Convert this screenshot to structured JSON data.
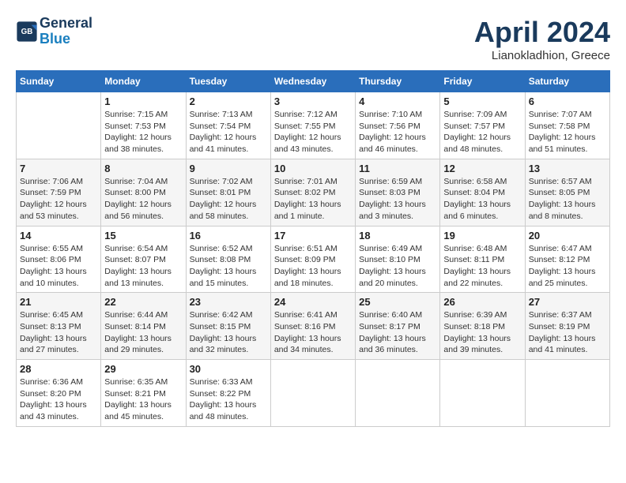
{
  "header": {
    "logo_line1": "General",
    "logo_line2": "Blue",
    "month": "April 2024",
    "location": "Lianokladhion, Greece"
  },
  "weekdays": [
    "Sunday",
    "Monday",
    "Tuesday",
    "Wednesday",
    "Thursday",
    "Friday",
    "Saturday"
  ],
  "weeks": [
    [
      {
        "day": "",
        "info": ""
      },
      {
        "day": "1",
        "info": "Sunrise: 7:15 AM\nSunset: 7:53 PM\nDaylight: 12 hours\nand 38 minutes."
      },
      {
        "day": "2",
        "info": "Sunrise: 7:13 AM\nSunset: 7:54 PM\nDaylight: 12 hours\nand 41 minutes."
      },
      {
        "day": "3",
        "info": "Sunrise: 7:12 AM\nSunset: 7:55 PM\nDaylight: 12 hours\nand 43 minutes."
      },
      {
        "day": "4",
        "info": "Sunrise: 7:10 AM\nSunset: 7:56 PM\nDaylight: 12 hours\nand 46 minutes."
      },
      {
        "day": "5",
        "info": "Sunrise: 7:09 AM\nSunset: 7:57 PM\nDaylight: 12 hours\nand 48 minutes."
      },
      {
        "day": "6",
        "info": "Sunrise: 7:07 AM\nSunset: 7:58 PM\nDaylight: 12 hours\nand 51 minutes."
      }
    ],
    [
      {
        "day": "7",
        "info": "Sunrise: 7:06 AM\nSunset: 7:59 PM\nDaylight: 12 hours\nand 53 minutes."
      },
      {
        "day": "8",
        "info": "Sunrise: 7:04 AM\nSunset: 8:00 PM\nDaylight: 12 hours\nand 56 minutes."
      },
      {
        "day": "9",
        "info": "Sunrise: 7:02 AM\nSunset: 8:01 PM\nDaylight: 12 hours\nand 58 minutes."
      },
      {
        "day": "10",
        "info": "Sunrise: 7:01 AM\nSunset: 8:02 PM\nDaylight: 13 hours\nand 1 minute."
      },
      {
        "day": "11",
        "info": "Sunrise: 6:59 AM\nSunset: 8:03 PM\nDaylight: 13 hours\nand 3 minutes."
      },
      {
        "day": "12",
        "info": "Sunrise: 6:58 AM\nSunset: 8:04 PM\nDaylight: 13 hours\nand 6 minutes."
      },
      {
        "day": "13",
        "info": "Sunrise: 6:57 AM\nSunset: 8:05 PM\nDaylight: 13 hours\nand 8 minutes."
      }
    ],
    [
      {
        "day": "14",
        "info": "Sunrise: 6:55 AM\nSunset: 8:06 PM\nDaylight: 13 hours\nand 10 minutes."
      },
      {
        "day": "15",
        "info": "Sunrise: 6:54 AM\nSunset: 8:07 PM\nDaylight: 13 hours\nand 13 minutes."
      },
      {
        "day": "16",
        "info": "Sunrise: 6:52 AM\nSunset: 8:08 PM\nDaylight: 13 hours\nand 15 minutes."
      },
      {
        "day": "17",
        "info": "Sunrise: 6:51 AM\nSunset: 8:09 PM\nDaylight: 13 hours\nand 18 minutes."
      },
      {
        "day": "18",
        "info": "Sunrise: 6:49 AM\nSunset: 8:10 PM\nDaylight: 13 hours\nand 20 minutes."
      },
      {
        "day": "19",
        "info": "Sunrise: 6:48 AM\nSunset: 8:11 PM\nDaylight: 13 hours\nand 22 minutes."
      },
      {
        "day": "20",
        "info": "Sunrise: 6:47 AM\nSunset: 8:12 PM\nDaylight: 13 hours\nand 25 minutes."
      }
    ],
    [
      {
        "day": "21",
        "info": "Sunrise: 6:45 AM\nSunset: 8:13 PM\nDaylight: 13 hours\nand 27 minutes."
      },
      {
        "day": "22",
        "info": "Sunrise: 6:44 AM\nSunset: 8:14 PM\nDaylight: 13 hours\nand 29 minutes."
      },
      {
        "day": "23",
        "info": "Sunrise: 6:42 AM\nSunset: 8:15 PM\nDaylight: 13 hours\nand 32 minutes."
      },
      {
        "day": "24",
        "info": "Sunrise: 6:41 AM\nSunset: 8:16 PM\nDaylight: 13 hours\nand 34 minutes."
      },
      {
        "day": "25",
        "info": "Sunrise: 6:40 AM\nSunset: 8:17 PM\nDaylight: 13 hours\nand 36 minutes."
      },
      {
        "day": "26",
        "info": "Sunrise: 6:39 AM\nSunset: 8:18 PM\nDaylight: 13 hours\nand 39 minutes."
      },
      {
        "day": "27",
        "info": "Sunrise: 6:37 AM\nSunset: 8:19 PM\nDaylight: 13 hours\nand 41 minutes."
      }
    ],
    [
      {
        "day": "28",
        "info": "Sunrise: 6:36 AM\nSunset: 8:20 PM\nDaylight: 13 hours\nand 43 minutes."
      },
      {
        "day": "29",
        "info": "Sunrise: 6:35 AM\nSunset: 8:21 PM\nDaylight: 13 hours\nand 45 minutes."
      },
      {
        "day": "30",
        "info": "Sunrise: 6:33 AM\nSunset: 8:22 PM\nDaylight: 13 hours\nand 48 minutes."
      },
      {
        "day": "",
        "info": ""
      },
      {
        "day": "",
        "info": ""
      },
      {
        "day": "",
        "info": ""
      },
      {
        "day": "",
        "info": ""
      }
    ]
  ]
}
